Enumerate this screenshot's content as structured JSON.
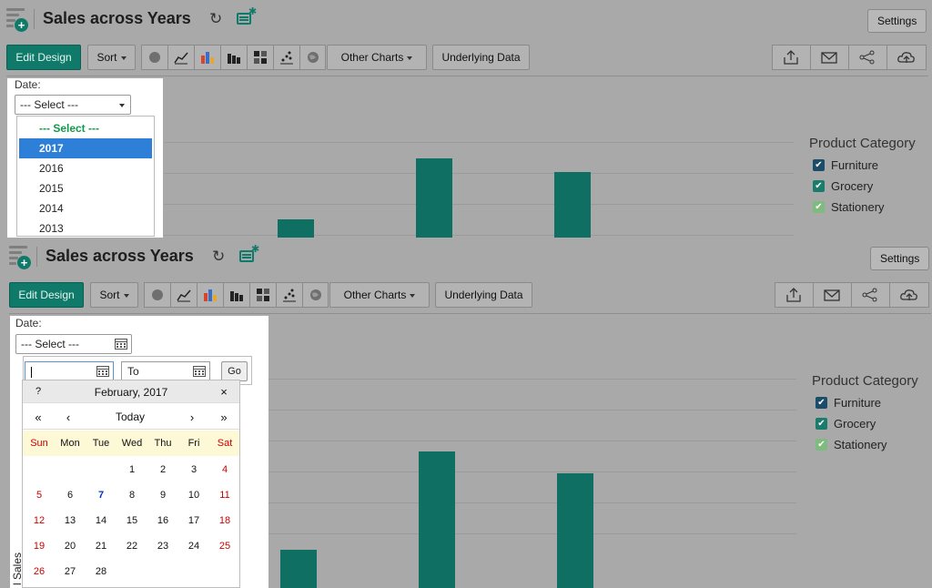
{
  "report": {
    "title": "Sales across Years",
    "settings_label": "Settings"
  },
  "toolbar": {
    "edit_design": "Edit Design",
    "sort": "Sort",
    "other_charts": "Other Charts",
    "underlying_data": "Underlying Data",
    "chart_icons": [
      "pie-chart-icon",
      "line-chart-icon",
      "bar-chart-icon",
      "stacked-bar-icon",
      "pivot-icon",
      "scatter-icon",
      "map-icon"
    ],
    "action_icons": [
      "export-icon",
      "email-icon",
      "share-icon",
      "publish-icon"
    ]
  },
  "filter": {
    "label": "Date:",
    "placeholder": "--- Select ---",
    "to_placeholder": "To",
    "go": "Go",
    "dropdown_options": [
      "--- Select ---",
      "2017",
      "2016",
      "2015",
      "2014",
      "2013"
    ],
    "selected_option": "2017"
  },
  "calendar": {
    "help": "?",
    "month": "February, 2017",
    "close": "×",
    "nav_prev_year": "«",
    "nav_prev_month": "‹",
    "nav_today": "Today",
    "nav_next_month": "›",
    "nav_next_year": "»",
    "weekdays": [
      "Sun",
      "Mon",
      "Tue",
      "Wed",
      "Thu",
      "Fri",
      "Sat"
    ],
    "weeks": [
      [
        "",
        "",
        "",
        "1",
        "2",
        "3",
        "4"
      ],
      [
        "5",
        "6",
        "7",
        "8",
        "9",
        "10",
        "11"
      ],
      [
        "12",
        "13",
        "14",
        "15",
        "16",
        "17",
        "18"
      ],
      [
        "19",
        "20",
        "21",
        "22",
        "23",
        "24",
        "25"
      ],
      [
        "26",
        "27",
        "28",
        "",
        "",
        "",
        ""
      ]
    ],
    "today": "7"
  },
  "legend": {
    "title": "Product Category",
    "items": [
      {
        "label": "Furniture",
        "color": "#1b4d6b"
      },
      {
        "label": "Grocery",
        "color": "#1c7c6c"
      },
      {
        "label": "Stationery",
        "color": "#7fba7f"
      }
    ]
  },
  "chart": {
    "yaxis_label": "l Sales",
    "bar_color": "#0e6f62"
  },
  "chart_data": {
    "type": "bar",
    "categories": [
      "",
      "",
      ""
    ],
    "values": [
      28,
      100,
      84
    ],
    "title": "",
    "xlabel": "",
    "ylabel": "l Sales"
  }
}
